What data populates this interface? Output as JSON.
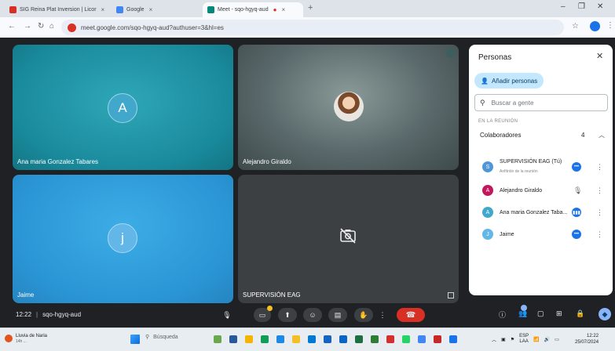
{
  "browser": {
    "tabs": [
      {
        "title": "SIG Reina Plat Inversion | Licor",
        "icon_color": "#d93025"
      },
      {
        "title": "Google",
        "icon_color": "#4285f4"
      },
      {
        "title": "Meet - sqo-hgyq-aud",
        "icon_color": "#00897b",
        "active": true
      }
    ],
    "url": "meet.google.com/sqo-hgyq-aud?authuser=3&hl=es"
  },
  "tiles": [
    {
      "name": "Ana maria Gonzalez Tabares",
      "avatar_letter": "A",
      "avatar_color": "#41a8cc"
    },
    {
      "name": "Alejandro Giraldo",
      "avatar": "photo"
    },
    {
      "name": "Jaime",
      "avatar_letter": "j",
      "avatar_color": "#63b6e8"
    },
    {
      "name": "SUPERVISIÓN EAG",
      "camera": "off"
    }
  ],
  "people_panel": {
    "title": "Personas",
    "add_label": "Añadir personas",
    "search_placeholder": "Buscar a gente",
    "section_label": "EN LA REUNIÓN",
    "group_title": "Colaboradores",
    "group_count": "4",
    "participants": [
      {
        "name": "SUPERVISIÓN EAG (Tú)",
        "subtitle": "Anfitrión de la reunión",
        "initial": "S",
        "color": "#4f97d8"
      },
      {
        "name": "Alejandro Giraldo",
        "initial": "A",
        "color": "#c2185b"
      },
      {
        "name": "Ana maria Gonzalez Taba...",
        "initial": "A",
        "color": "#41a8cc"
      },
      {
        "name": "Jaime",
        "initial": "J",
        "color": "#63b6e8"
      }
    ]
  },
  "controls": {
    "time": "12:22",
    "meeting_code": "sqo-hgyq-aud"
  },
  "taskbar": {
    "weather_title": "Lluvia de Naria",
    "weather_sub": "14h ...",
    "search_label": "Búsqueda",
    "lang_top": "ESP",
    "lang_bottom": "LAA",
    "clock_time": "12:22",
    "clock_date": "25/07/2024"
  },
  "colors": {
    "accent": "#1a73e8",
    "leave_red": "#d93025",
    "meet_bg": "#202124"
  }
}
